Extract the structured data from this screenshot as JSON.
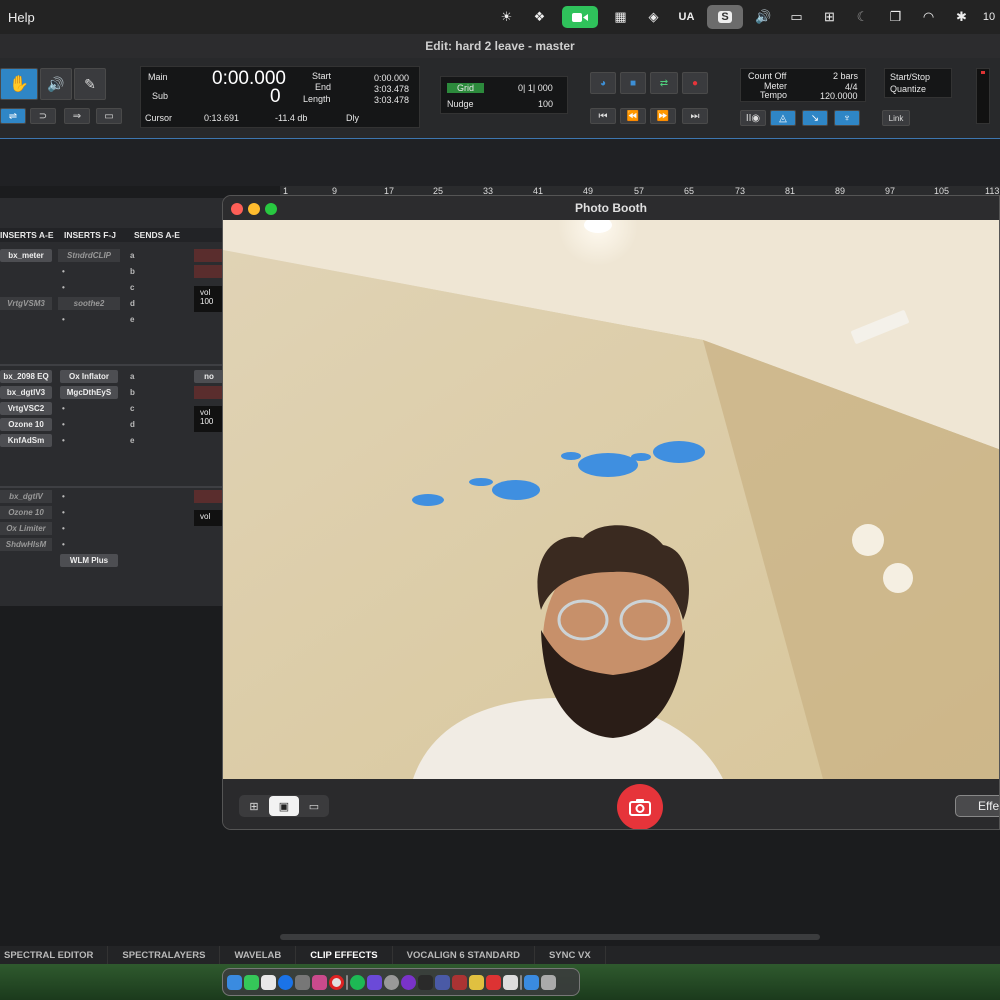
{
  "menubar": {
    "app_menu": "Help",
    "ua_label": "UA",
    "s_label": "S",
    "battery": "10"
  },
  "edit_window": {
    "title": "Edit: hard 2 leave - master"
  },
  "counters": {
    "main_label": "Main",
    "main_value": "0:00.000",
    "sub_label": "Sub",
    "sub_value": "0",
    "start_label": "Start",
    "start_value": "0:00.000",
    "end_label": "End",
    "end_value": "3:03.478",
    "length_label": "Length",
    "length_value": "3:03.478",
    "cursor_label": "Cursor",
    "cursor_value": "0:13.691",
    "cursor_db": "-11.4 db",
    "dly_label": "Dly"
  },
  "grid": {
    "grid_label": "Grid",
    "grid_value": "0| 1| 000",
    "nudge_label": "Nudge",
    "nudge_value": "100"
  },
  "midi": {
    "count_off": "Count Off",
    "count_bars": "2 bars",
    "meter_label": "Meter",
    "meter_value": "4/4",
    "tempo_label": "Tempo",
    "tempo_value": "120.0000",
    "start_stop": "Start/Stop",
    "quantize": "Quantize",
    "link": "Link"
  },
  "ruler": [
    "1",
    "9",
    "17",
    "25",
    "33",
    "41",
    "49",
    "57",
    "65",
    "73",
    "81",
    "89",
    "97",
    "105",
    "113"
  ],
  "mixer": {
    "headers": [
      "INSERTS A-E",
      "INSERTS F-J",
      "SENDS A-E"
    ],
    "track1": {
      "ins_ae": [
        "bx_meter",
        "",
        "",
        "VrtgVSM3",
        ""
      ],
      "ins_fj": [
        "StndrdCLIP",
        "",
        "",
        "soothe2",
        ""
      ],
      "sends": [
        "a",
        "b",
        "c",
        "d",
        "e"
      ],
      "vol_label": "vol",
      "vol_value": "100"
    },
    "track2": {
      "ins_ae": [
        "bx_2098 EQ",
        "bx_dgtlV3",
        "VrtgVSC2",
        "Ozone 10",
        "KnfAdSm"
      ],
      "ins_fj": [
        "Ox Inflator",
        "MgcDthEyS",
        "",
        "",
        ""
      ],
      "sends": [
        "a",
        "b",
        "c",
        "d",
        "e"
      ],
      "no_label": "no",
      "vol_label": "vol",
      "vol_value": "100"
    },
    "track3": {
      "ins_ae": [
        "bx_dgtlV",
        "Ozone 10",
        "Ox Limiter",
        "ShdwHlsM"
      ],
      "ins_fj": [
        "",
        "",
        "",
        "",
        "WLM Plus"
      ],
      "vol_label": "vol"
    }
  },
  "tabs": [
    "SPECTRAL EDITOR",
    "SPECTRALAYERS",
    "WAVELAB",
    "CLIP EFFECTS",
    "VOCALIGN 6 STANDARD",
    "SYNC VX"
  ],
  "photo_booth": {
    "title": "Photo Booth",
    "effects_label": "Effe"
  },
  "colors": {
    "accent_blue": "#2f86c6",
    "record_red": "#e6343a",
    "green_badge": "#2fc25b"
  }
}
